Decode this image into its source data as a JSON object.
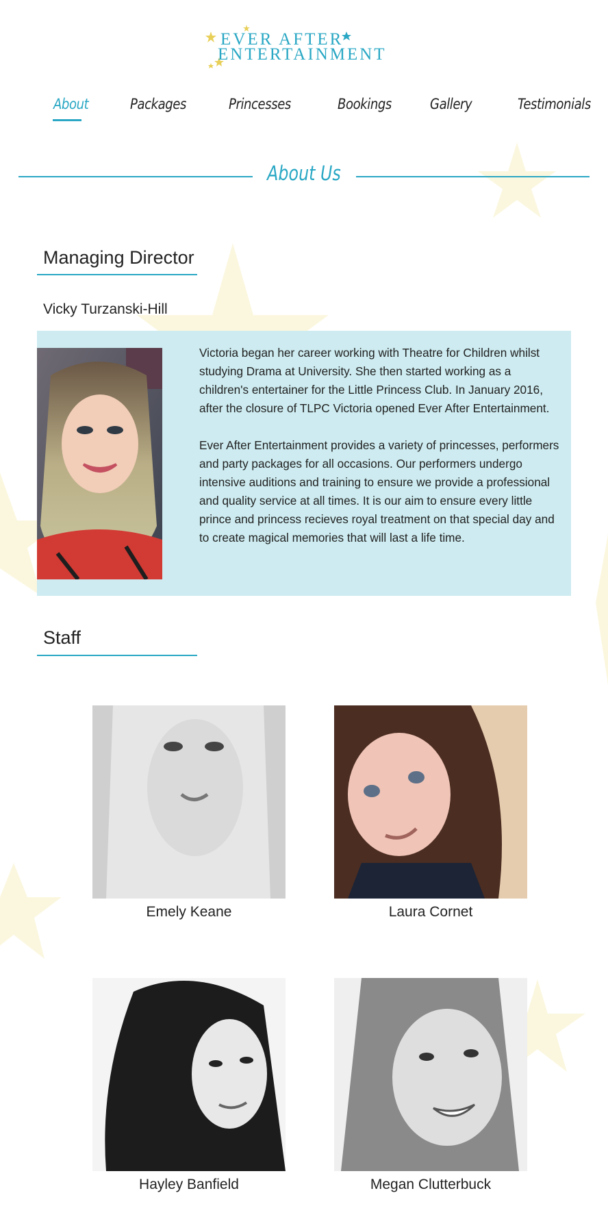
{
  "brand": {
    "logo_line1": "EVER AFTER",
    "logo_line2": "ENTERTAINMENT",
    "accent_color": "#29a7c4",
    "star_color": "#f4e79c"
  },
  "nav": {
    "items": [
      {
        "label": "About",
        "active": true
      },
      {
        "label": "Packages",
        "active": false
      },
      {
        "label": "Princesses",
        "active": false
      },
      {
        "label": "Bookings",
        "active": false
      },
      {
        "label": "Gallery",
        "active": false
      },
      {
        "label": "Testimonials",
        "active": false
      }
    ]
  },
  "page": {
    "title": "About Us"
  },
  "director": {
    "heading": "Managing Director",
    "name": "Vicky Turzanski-Hill",
    "bio": [
      "Victoria began her career working with Theatre for Children whilst studying Drama at University. She then started working as a children's entertainer for the Little Princess Club. In January 2016, after the closure of TLPC Victoria opened Ever After Entertainment.",
      "Ever After Entertainment provides a variety of princesses, performers and party packages for all occasions. Our performers undergo intensive auditions and training to ensure we provide a professional and quality service at all times. It is our aim to ensure every little prince and princess recieves royal treatment on that special day and to create magical memories that will last a life time."
    ]
  },
  "staff": {
    "heading": "Staff",
    "members": [
      {
        "name": "Emely Keane"
      },
      {
        "name": "Laura Cornet"
      },
      {
        "name": "Hayley Banfield"
      },
      {
        "name": "Megan Clutterbuck"
      }
    ]
  }
}
